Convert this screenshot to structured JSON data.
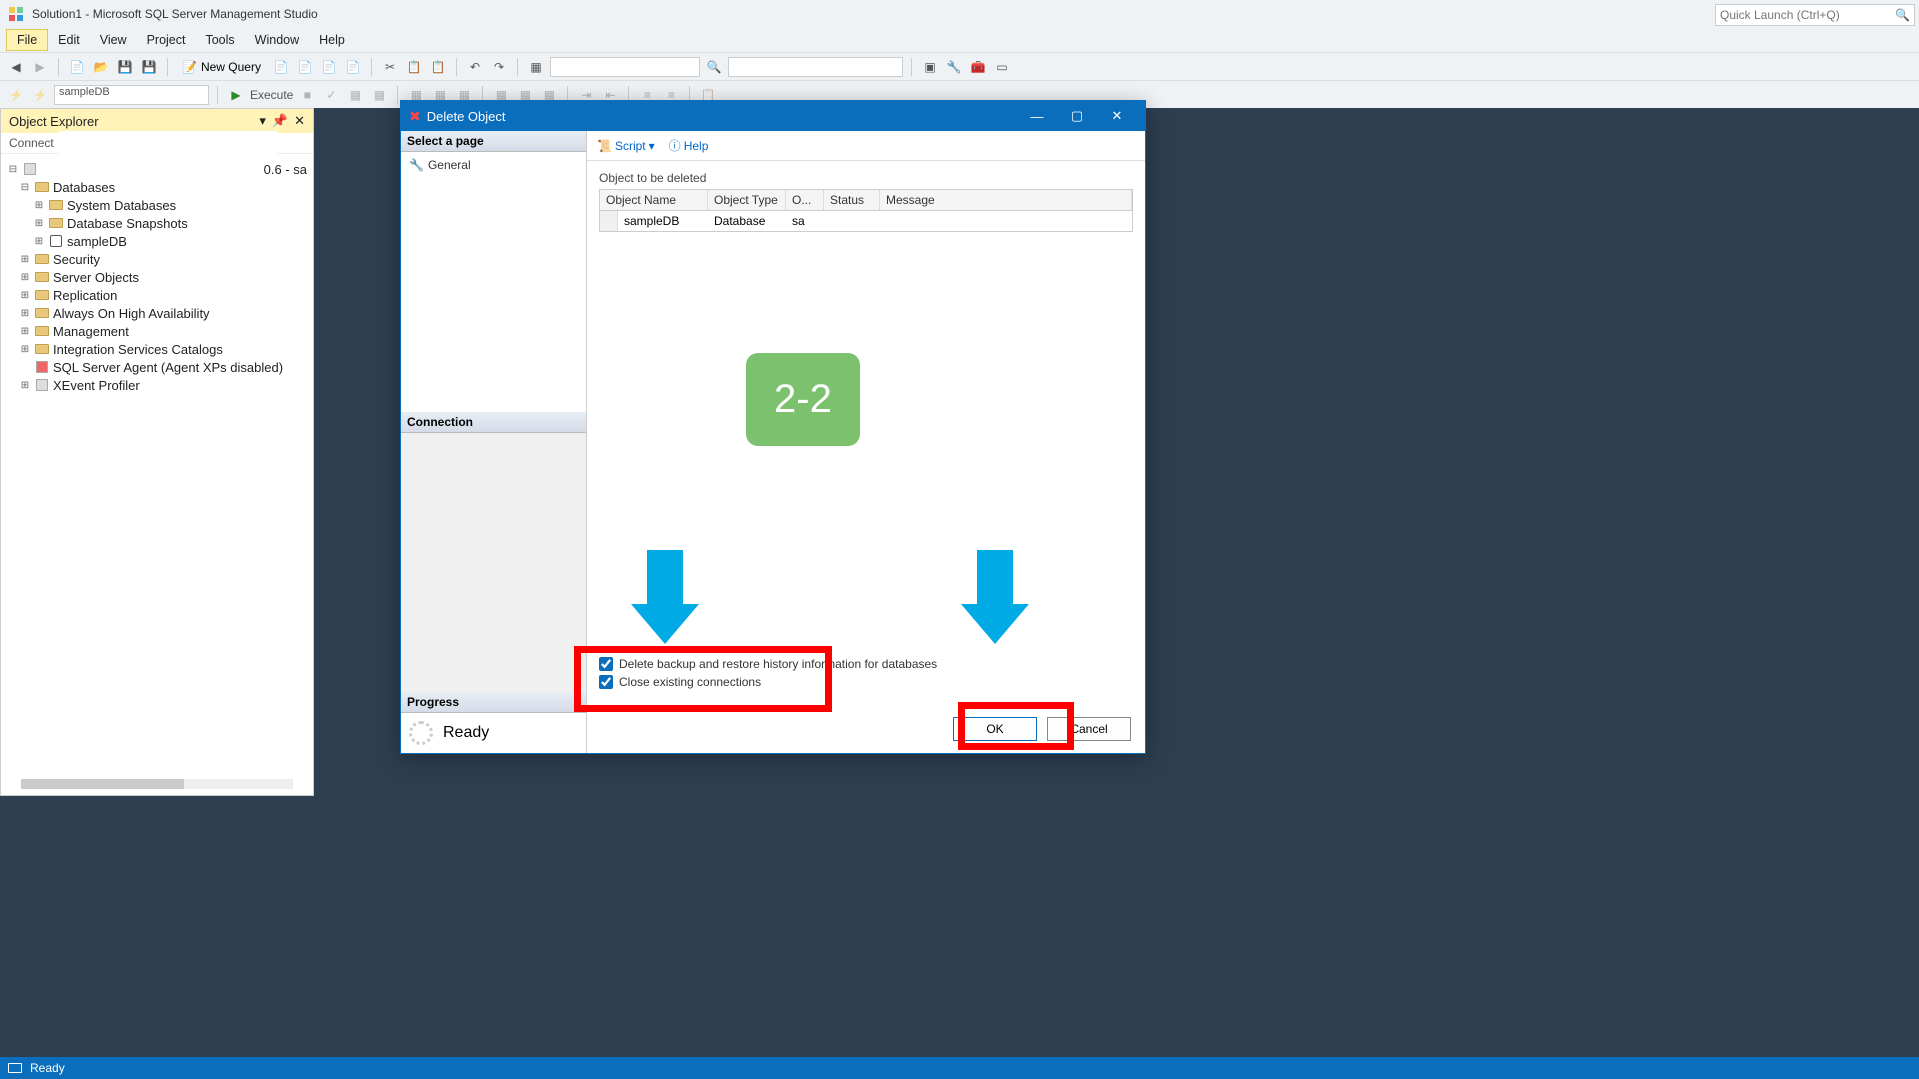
{
  "window": {
    "title": "Solution1 - Microsoft SQL Server Management Studio"
  },
  "quicklaunch": {
    "placeholder": "Quick Launch (Ctrl+Q)"
  },
  "menu": {
    "file": "File",
    "edit": "Edit",
    "view": "View",
    "project": "Project",
    "tools": "Tools",
    "window": "Window",
    "help": "Help"
  },
  "toolbar": {
    "new_query": "New Query",
    "execute": "Execute",
    "db_combo": "sampleDB"
  },
  "explorer": {
    "title": "Object Explorer",
    "connect": "Connect",
    "server_suffix": "0.6 - sa",
    "nodes": {
      "databases": "Databases",
      "system_databases": "System Databases",
      "database_snapshots": "Database Snapshots",
      "sampledb": "sampleDB",
      "security": "Security",
      "server_objects": "Server Objects",
      "replication": "Replication",
      "always_on": "Always On High Availability",
      "management": "Management",
      "integration": "Integration Services Catalogs",
      "sql_agent": "SQL Server Agent (Agent XPs disabled)",
      "xevent": "XEvent Profiler"
    }
  },
  "dialog": {
    "title": "Delete Object",
    "select_page": "Select a page",
    "general": "General",
    "connection": "Connection",
    "progress": "Progress",
    "ready": "Ready",
    "script": "Script",
    "help": "Help",
    "object_label": "Object to be deleted",
    "columns": {
      "name": "Object Name",
      "type": "Object Type",
      "owner": "O...",
      "status": "Status",
      "message": "Message"
    },
    "row": {
      "name": "sampleDB",
      "type": "Database",
      "owner": "sa",
      "status": "",
      "message": ""
    },
    "chk_delete_backup": "Delete backup and restore history information for databases",
    "chk_close_conn": "Close existing connections",
    "ok": "OK",
    "cancel": "Cancel"
  },
  "overlay": {
    "badge": "2-2"
  },
  "statusbar": {
    "ready": "Ready"
  }
}
